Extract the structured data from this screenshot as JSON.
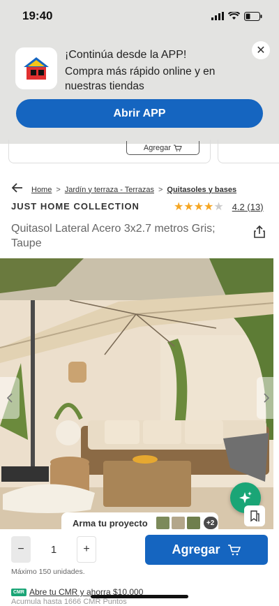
{
  "status_bar": {
    "time": "19:40"
  },
  "app_banner": {
    "title": "¡Continúa desde la APP!",
    "text": "Compra más rápido online y en nuestras tiendas",
    "open_button": "Abrir APP",
    "close_symbol": "✕"
  },
  "peek": {
    "add_label": "Agregar"
  },
  "breadcrumb": {
    "items": [
      "Home",
      "Jardín y terraza - Terrazas",
      "Quitasoles y bases"
    ],
    "separator": ">"
  },
  "product": {
    "brand": "JUST HOME COLLECTION",
    "rating_text": "4.2 (13)",
    "rating_value": 4.2,
    "title": "Quitasol Lateral Acero 3x2.7 metros Gris; Taupe"
  },
  "gallery": {
    "project_label": "Arma tu proyecto",
    "extra_count": "+2"
  },
  "purchase": {
    "quantity": "1",
    "minus": "−",
    "plus": "+",
    "add_label": "Agregar",
    "max_text": "Máximo 150 unidades."
  },
  "cmr": {
    "logo": "CMR",
    "text": "Abre tu CMR y ahorra $10.000",
    "subtext": "Acumula hasta 1666 CMR Puntos"
  },
  "colors": {
    "primary": "#1565c0",
    "accent_green": "#1aa576",
    "star": "#f5a623"
  }
}
